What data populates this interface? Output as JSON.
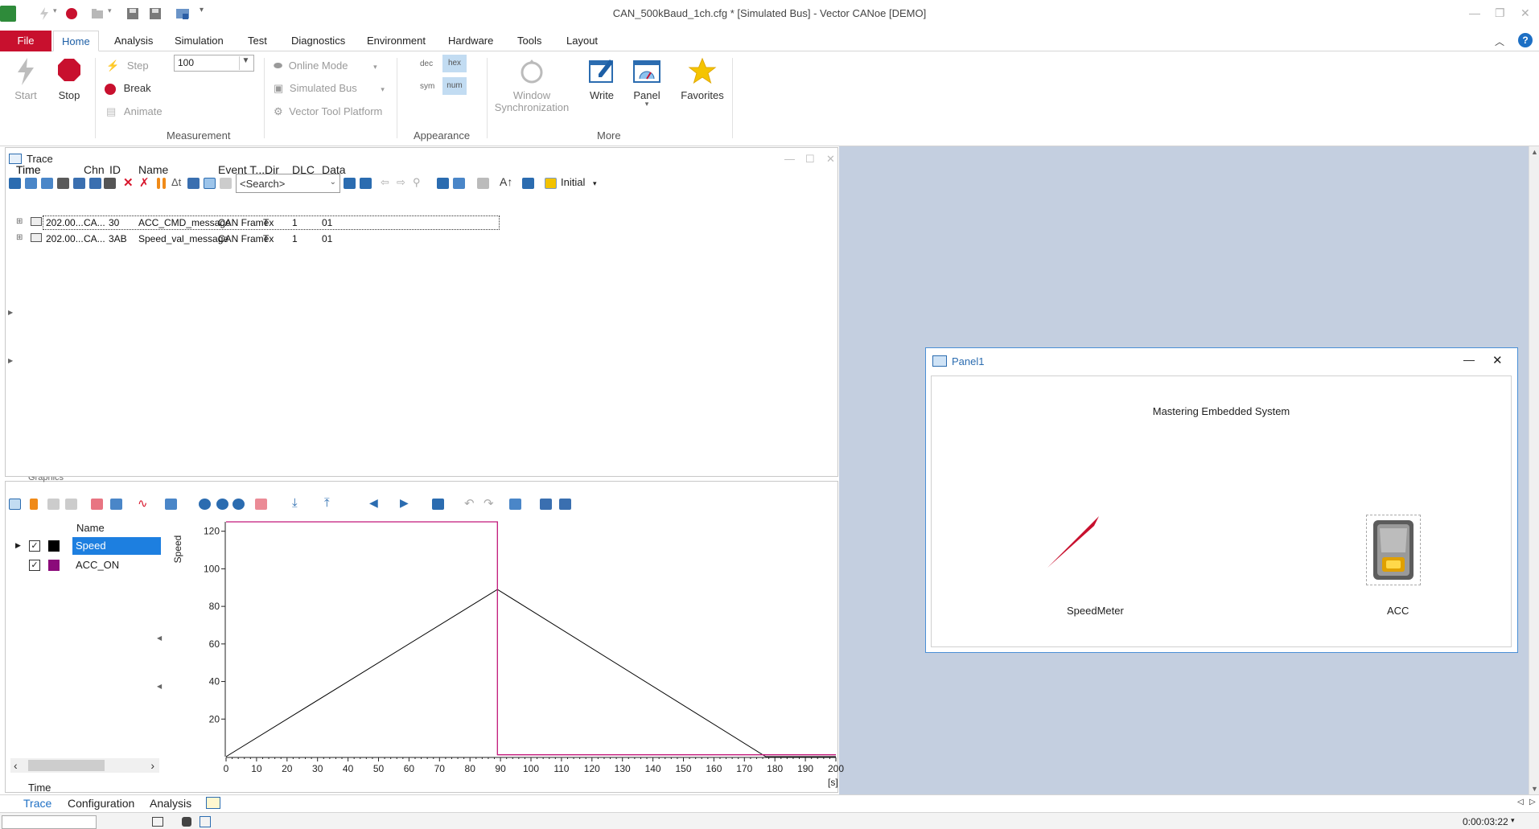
{
  "window": {
    "title": "CAN_500kBaud_1ch.cfg * [Simulated Bus] - Vector CANoe [DEMO]"
  },
  "ribbon_tabs": [
    "File",
    "Home",
    "Analysis",
    "Simulation",
    "Test",
    "Diagnostics",
    "Environment",
    "Hardware",
    "Tools",
    "Layout"
  ],
  "ribbon": {
    "start": "Start",
    "stop": "Stop",
    "step": "Step",
    "break": "Break",
    "animate": "Animate",
    "animation_speed": "100",
    "online_mode": "Online Mode",
    "simulated_bus": "Simulated Bus",
    "vector_tool_platform": "Vector Tool Platform",
    "measurement_group": "Measurement",
    "dec": "dec",
    "hex": "hex",
    "sym": "sym",
    "num": "num",
    "appearance_group": "Appearance",
    "window_sync_1": "Window",
    "window_sync_2": "Synchronization",
    "write": "Write",
    "panel": "Panel",
    "favorites": "Favorites",
    "more_group": "More"
  },
  "trace": {
    "title": "Trace",
    "search_placeholder": "<Search>",
    "initial": "Initial",
    "columns": [
      "Time",
      "Chn",
      "ID",
      "Name",
      "Event T...",
      "Dir",
      "DLC",
      "Data"
    ],
    "rows": [
      [
        "202.00...",
        "CA...",
        "30",
        "ACC_CMD_message",
        "CAN Frame",
        "Tx",
        "1",
        "01"
      ],
      [
        "202.00...",
        "CA...",
        "3AB",
        "Speed_val_message",
        "CAN Frame",
        "Tx",
        "1",
        "01"
      ]
    ]
  },
  "graphics": {
    "title": "Graphics",
    "name_header": "Name",
    "signals": [
      {
        "name": "Speed",
        "color": "#000000",
        "checked": true
      },
      {
        "name": "ACC_ON",
        "color": "#8b0a7a",
        "checked": true
      }
    ],
    "time_label": "Time",
    "ylabel": "Speed",
    "x_unit": "[s]"
  },
  "chart_data": {
    "type": "line",
    "ylabel": "Speed",
    "xlabel": "[s]",
    "xlim": [
      0,
      200
    ],
    "ylim": [
      0,
      125
    ],
    "x_ticks": [
      0,
      10,
      20,
      30,
      40,
      50,
      60,
      70,
      80,
      90,
      100,
      110,
      120,
      130,
      140,
      150,
      160,
      170,
      180,
      190,
      200
    ],
    "y_ticks": [
      20,
      40,
      60,
      80,
      100,
      120
    ],
    "series": [
      {
        "name": "Speed",
        "color": "#000000",
        "x": [
          0,
          89,
          177,
          200
        ],
        "y": [
          0,
          89,
          0,
          0
        ]
      },
      {
        "name": "ACC_ON",
        "color": "#c2187a",
        "x": [
          0,
          89,
          89,
          200
        ],
        "y": [
          128,
          128,
          1,
          1
        ]
      }
    ]
  },
  "panel": {
    "title": "Panel1",
    "heading": "Mastering Embedded System",
    "speedometer_label": "SpeedMeter",
    "acc_label": "ACC"
  },
  "bottom_tabs": [
    "Trace",
    "Configuration",
    "Analysis"
  ],
  "status": {
    "time": "0:00:03:22"
  }
}
